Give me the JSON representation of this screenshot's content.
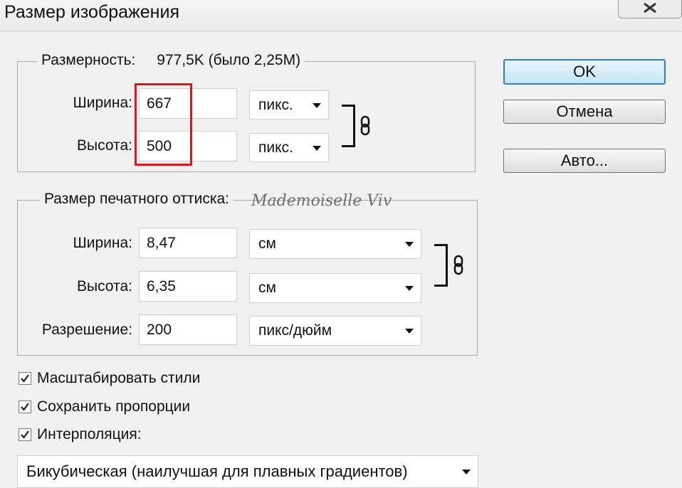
{
  "window": {
    "title": "Размер изображения"
  },
  "pixel_dimensions": {
    "legend_label": "Размерность:",
    "legend_value": "977,5K (было 2,25M)",
    "width": {
      "label": "Ширина:",
      "value": "667",
      "unit": "пикс."
    },
    "height": {
      "label": "Высота:",
      "value": "500",
      "unit": "пикс."
    }
  },
  "document_size": {
    "legend": "Размер печатного оттиска:",
    "width": {
      "label": "Ширина:",
      "value": "8,47",
      "unit": "см"
    },
    "height": {
      "label": "Высота:",
      "value": "6,35",
      "unit": "см"
    },
    "resolution": {
      "label": "Разрешение:",
      "value": "200",
      "unit": "пикс/дюйм"
    }
  },
  "buttons": {
    "ok": "OK",
    "cancel": "Отмена",
    "auto": "Авто..."
  },
  "options": {
    "scale_styles": {
      "label": "Масштабировать стили",
      "checked": true
    },
    "constrain": {
      "label": "Сохранить пропорции",
      "checked": true
    },
    "resample": {
      "label": "Интерполяция:",
      "checked": true
    }
  },
  "resample_method": "Бикубическая (наилучшая для плавных градиентов)",
  "watermark": "Mademoiselle Viv",
  "colors": {
    "highlight": "#d7191c",
    "default_button_border": "#3c7fb1"
  }
}
